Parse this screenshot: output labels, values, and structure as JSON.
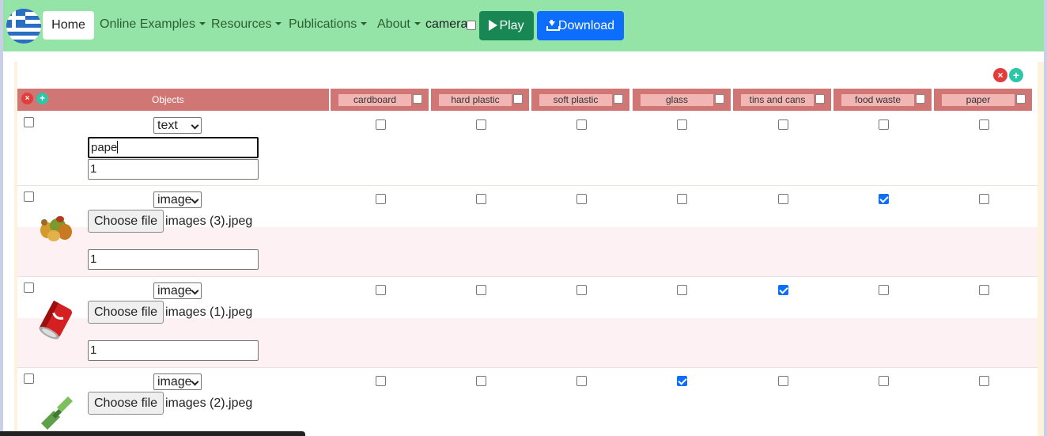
{
  "navbar": {
    "home_label": "Home",
    "links": [
      {
        "label": "Online Examples"
      },
      {
        "label": "Resources"
      },
      {
        "label": "Publications"
      },
      {
        "label": "About"
      }
    ],
    "camera_label": "camera",
    "play_label": "Play",
    "download_label": "Download"
  },
  "table": {
    "objects_header": "Objects",
    "categories": [
      {
        "label": "cardboard"
      },
      {
        "label": "hard plastic"
      },
      {
        "label": "soft plastic"
      },
      {
        "label": "glass"
      },
      {
        "label": "tins and cans"
      },
      {
        "label": "food waste"
      },
      {
        "label": "paper"
      }
    ],
    "rows": [
      {
        "type": "text",
        "text_value": "pape",
        "weight": "1",
        "checked": []
      },
      {
        "type": "image",
        "choose_label": "Choose file",
        "file_name": "images (3).jpeg",
        "weight": "1",
        "checked": [
          "food waste"
        ]
      },
      {
        "type": "image",
        "choose_label": "Choose file",
        "file_name": "images (1).jpeg",
        "weight": "1",
        "checked": [
          "tins and cans"
        ]
      },
      {
        "type": "image",
        "choose_label": "Choose file",
        "file_name": "images (2).jpeg",
        "weight": "",
        "checked": [
          "glass"
        ]
      }
    ]
  },
  "colors": {
    "navbar_bg": "#94e3a7",
    "header_bg": "#d07775",
    "play_btn": "#198754",
    "download_btn": "#0d6efd"
  }
}
